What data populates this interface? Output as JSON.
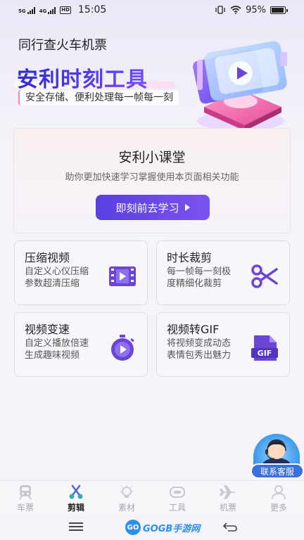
{
  "status_bar": {
    "signal1": "5G",
    "signal2": "4G",
    "hd": "HD",
    "time": "15:05",
    "battery_pct": "95%",
    "battery_level": 0.95
  },
  "header": {
    "app_title": "同行查火车机票",
    "banner_title": "安利时刻工具",
    "banner_subtitle": "安全存储、便利处理每一帧每一刻"
  },
  "classroom": {
    "title": "安利小课堂",
    "desc": "助你更加快速学习掌握使用本页面相关功能",
    "button": "即刻前去学习"
  },
  "features": [
    {
      "title": "压缩视频",
      "desc": "自定义心仪压缩 参数超清压缩",
      "icon": "film-icon"
    },
    {
      "title": "时长裁剪",
      "desc": "每一帧每一刻极度精细化裁剪",
      "icon": "scissors-icon"
    },
    {
      "title": "视频变速",
      "desc": "自定义播放倍速生成趣味视频",
      "icon": "stopwatch-icon"
    },
    {
      "title": "视频转GIF",
      "desc": "将视频变成动态表情包秀出魅力",
      "icon": "gif-file-icon"
    }
  ],
  "gif_icon_text": "GIF",
  "customer_service": {
    "label": "联系客服"
  },
  "bottom_nav": [
    {
      "label": "车票",
      "icon": "train-icon",
      "active": false
    },
    {
      "label": "剪辑",
      "icon": "scissors-icon",
      "active": true
    },
    {
      "label": "素材",
      "icon": "lightbulb-icon",
      "active": false
    },
    {
      "label": "工具",
      "icon": "toolbox-icon",
      "active": false
    },
    {
      "label": "机票",
      "icon": "airplane-icon",
      "active": false
    },
    {
      "label": "更多",
      "icon": "person-icon",
      "active": false
    }
  ],
  "watermark": {
    "logo": "GO",
    "text": "GOGB手游网"
  },
  "colors": {
    "accent": "#5b3fe3",
    "cs_blue": "#3a6fe0",
    "icon_purple": "#6a45d6"
  }
}
